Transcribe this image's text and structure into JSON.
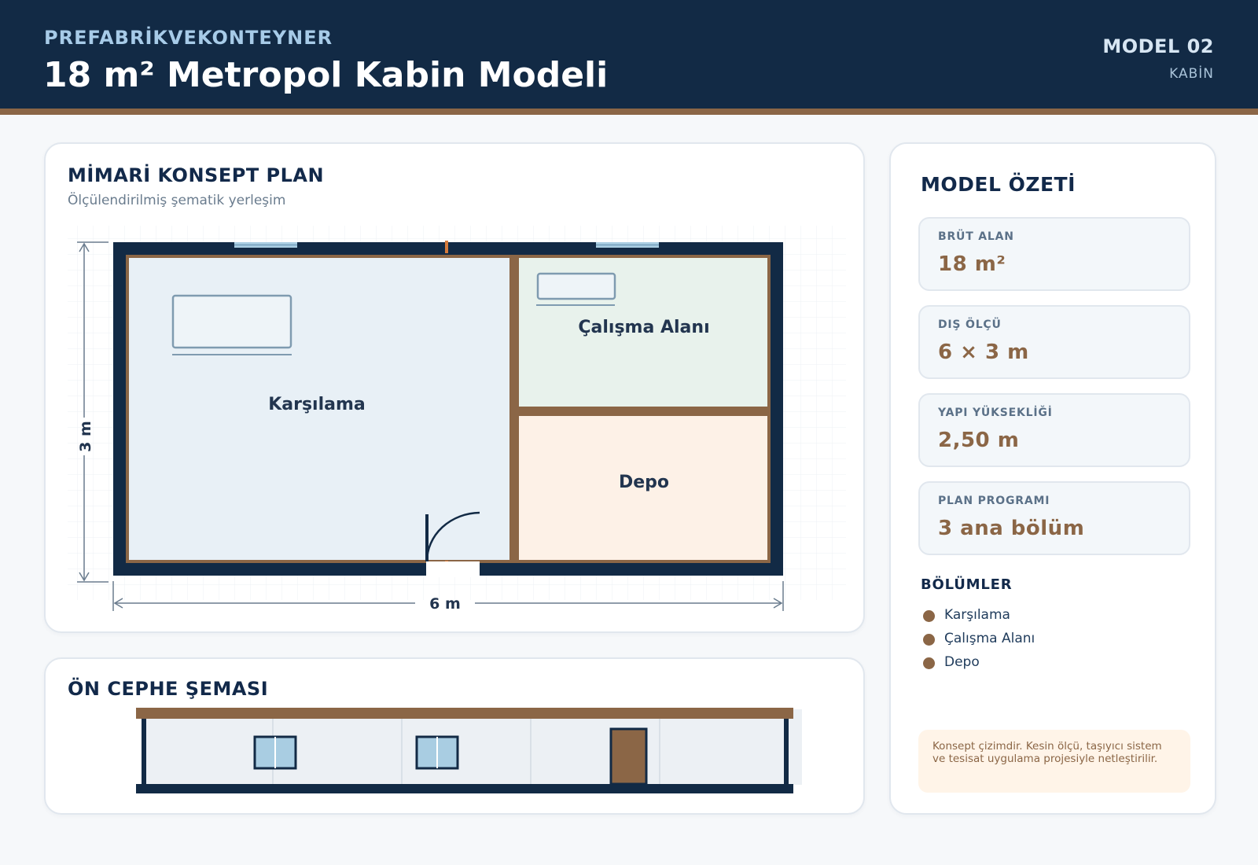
{
  "header": {
    "brand": "PREFABRİKVEKONTEYNER",
    "title": "18 m² Metropol Kabin Modeli",
    "model_label": "MODEL 02",
    "model_type": "KABİN"
  },
  "plan": {
    "title": "MİMARİ KONSEPT PLAN",
    "subtitle": "Ölçülendirilmiş şematik yerleşim",
    "rooms": [
      {
        "name": "Karşılama",
        "fill": "#e8f0f6"
      },
      {
        "name": "Çalışma Alanı",
        "fill": "#e8f2ec"
      },
      {
        "name": "Depo",
        "fill": "#fdf1e7"
      }
    ],
    "dim_width": "6 m",
    "dim_height": "3 m"
  },
  "facade": {
    "title": "ÖN CEPHE ŞEMASI"
  },
  "summary": {
    "title": "MODEL ÖZETİ",
    "stats": [
      {
        "label": "BRÜT ALAN",
        "value": "18 m²"
      },
      {
        "label": "DIŞ ÖLÇÜ",
        "value": "6 × 3 m"
      },
      {
        "label": "YAPI YÜKSEKLİĞİ",
        "value": "2,50 m"
      },
      {
        "label": "PLAN PROGRAMI",
        "value": "3 ana bölüm"
      }
    ],
    "sections_title": "BÖLÜMLER",
    "sections": [
      "Karşılama",
      "Çalışma Alanı",
      "Depo"
    ],
    "note": "Konsept çizimdir. Kesin ölçü, taşıyıcı sistem ve tesisat uygulama projesiyle netleştirilir."
  },
  "colors": {
    "navy": "#122a45",
    "brown": "#8b6646",
    "window": "#a9cde2"
  }
}
